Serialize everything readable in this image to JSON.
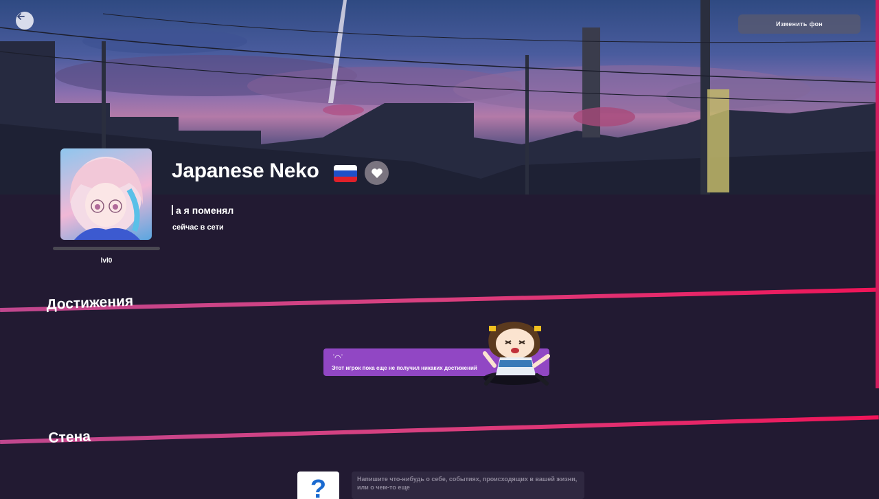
{
  "header": {
    "back_icon": "arrow-left-icon",
    "change_background_label": "Изменить фон"
  },
  "profile": {
    "username": "Japanese Neko",
    "country_flag": "russia-flag",
    "status_text": "а я поменял",
    "online_text": "сейчас в сети",
    "level_label": "lvl0",
    "level_progress": 0,
    "favorite_icon": "heart-icon"
  },
  "achievements": {
    "title": "Достижения",
    "empty_icon": "sad-face",
    "empty_text": "Этот игрок пока еще не получил никаких достижений"
  },
  "wall": {
    "title": "Стена",
    "avatar_glyph": "?",
    "input_placeholder": "Напишите что-нибудь о себе, событиях, происходящих в вашей жизни, или о чем-то еще"
  },
  "colors": {
    "page_bg": "#221a32",
    "accent_pink": "#f01458",
    "accent_purple": "#9147c4"
  }
}
